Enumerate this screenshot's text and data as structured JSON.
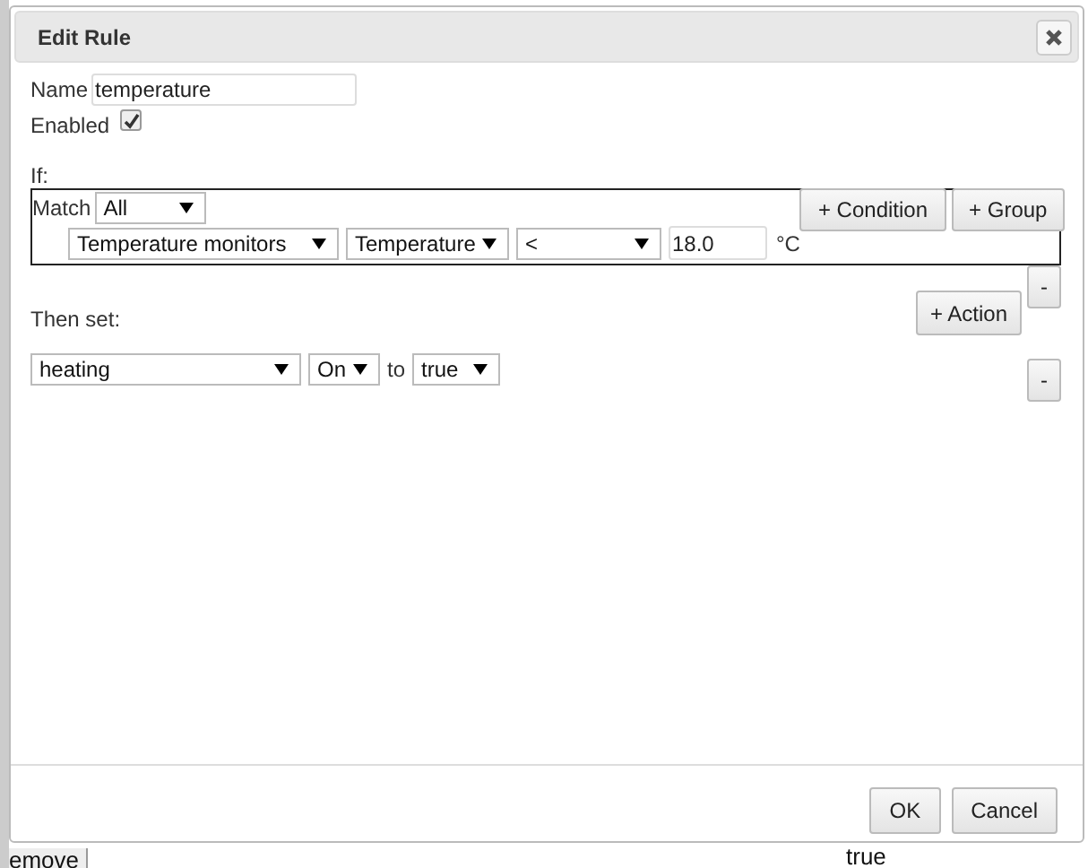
{
  "window": {
    "title": "Edit Rule"
  },
  "name_field": {
    "label": "Name",
    "value": "temperature"
  },
  "enabled": {
    "label": "Enabled",
    "checked": true
  },
  "if_label": "If:",
  "condition_group": {
    "match_label": "Match",
    "match": "All",
    "add_condition": "+ Condition",
    "add_group": "+ Group",
    "remove": "-",
    "conditions": [
      {
        "device": "Temperature monitors",
        "property": "Temperature",
        "operator": "<",
        "value": "18.0",
        "unit": "°C"
      }
    ]
  },
  "then_label": "Then set:",
  "add_action": "+ Action",
  "actions": [
    {
      "device": "heating",
      "property": "On",
      "to_label": "to",
      "value": "true",
      "remove": "-"
    }
  ],
  "buttons": [
    "OK",
    "Cancel"
  ],
  "background_cells": [
    "emove",
    "true"
  ]
}
